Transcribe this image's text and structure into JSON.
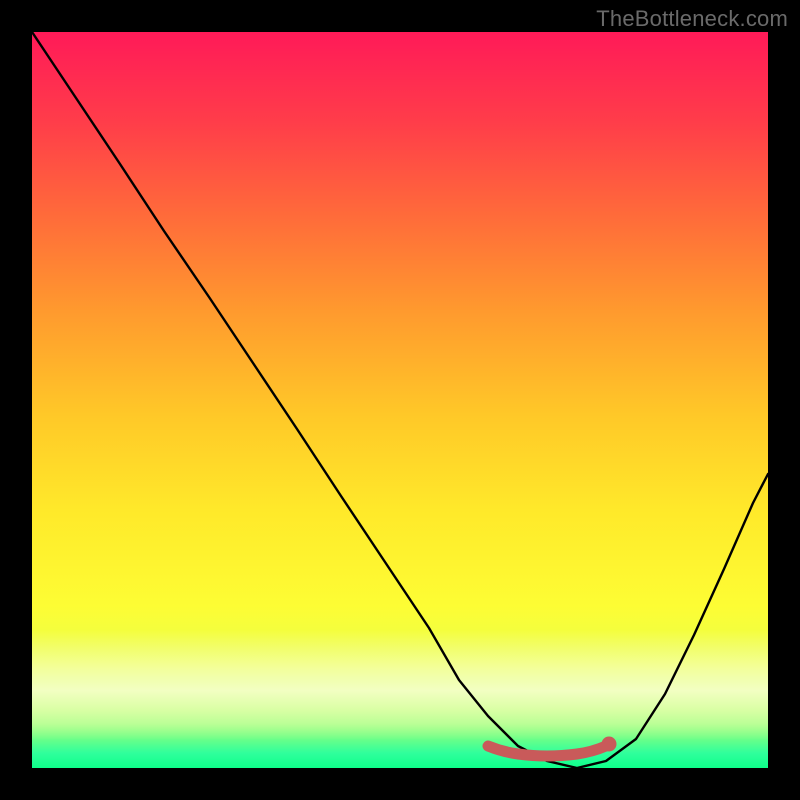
{
  "attribution": "TheBottleneck.com",
  "colors": {
    "frame": "#000000",
    "curve_stroke": "#000000",
    "optimal_marker": "#c95a5a",
    "gradient_top": "#ff1a58",
    "gradient_bottom": "#0eff8a"
  },
  "chart_data": {
    "type": "line",
    "title": "",
    "xlabel": "",
    "ylabel": "",
    "xlim": [
      0,
      100
    ],
    "ylim": [
      0,
      100
    ],
    "series": [
      {
        "name": "bottleneck-curve",
        "x": [
          0,
          6,
          12,
          18,
          24,
          30,
          36,
          42,
          48,
          54,
          58,
          62,
          66,
          70,
          74,
          78,
          82,
          86,
          90,
          94,
          98,
          100
        ],
        "values": [
          100,
          91,
          82,
          73,
          64,
          55,
          46,
          37,
          28,
          19,
          12,
          7,
          3,
          1,
          0,
          1,
          4,
          10,
          18,
          27,
          36,
          40
        ]
      },
      {
        "name": "optimal-segment",
        "x": [
          62,
          66,
          70,
          74,
          78
        ],
        "values": [
          3,
          2,
          1.5,
          2,
          3
        ]
      }
    ],
    "annotations": []
  }
}
